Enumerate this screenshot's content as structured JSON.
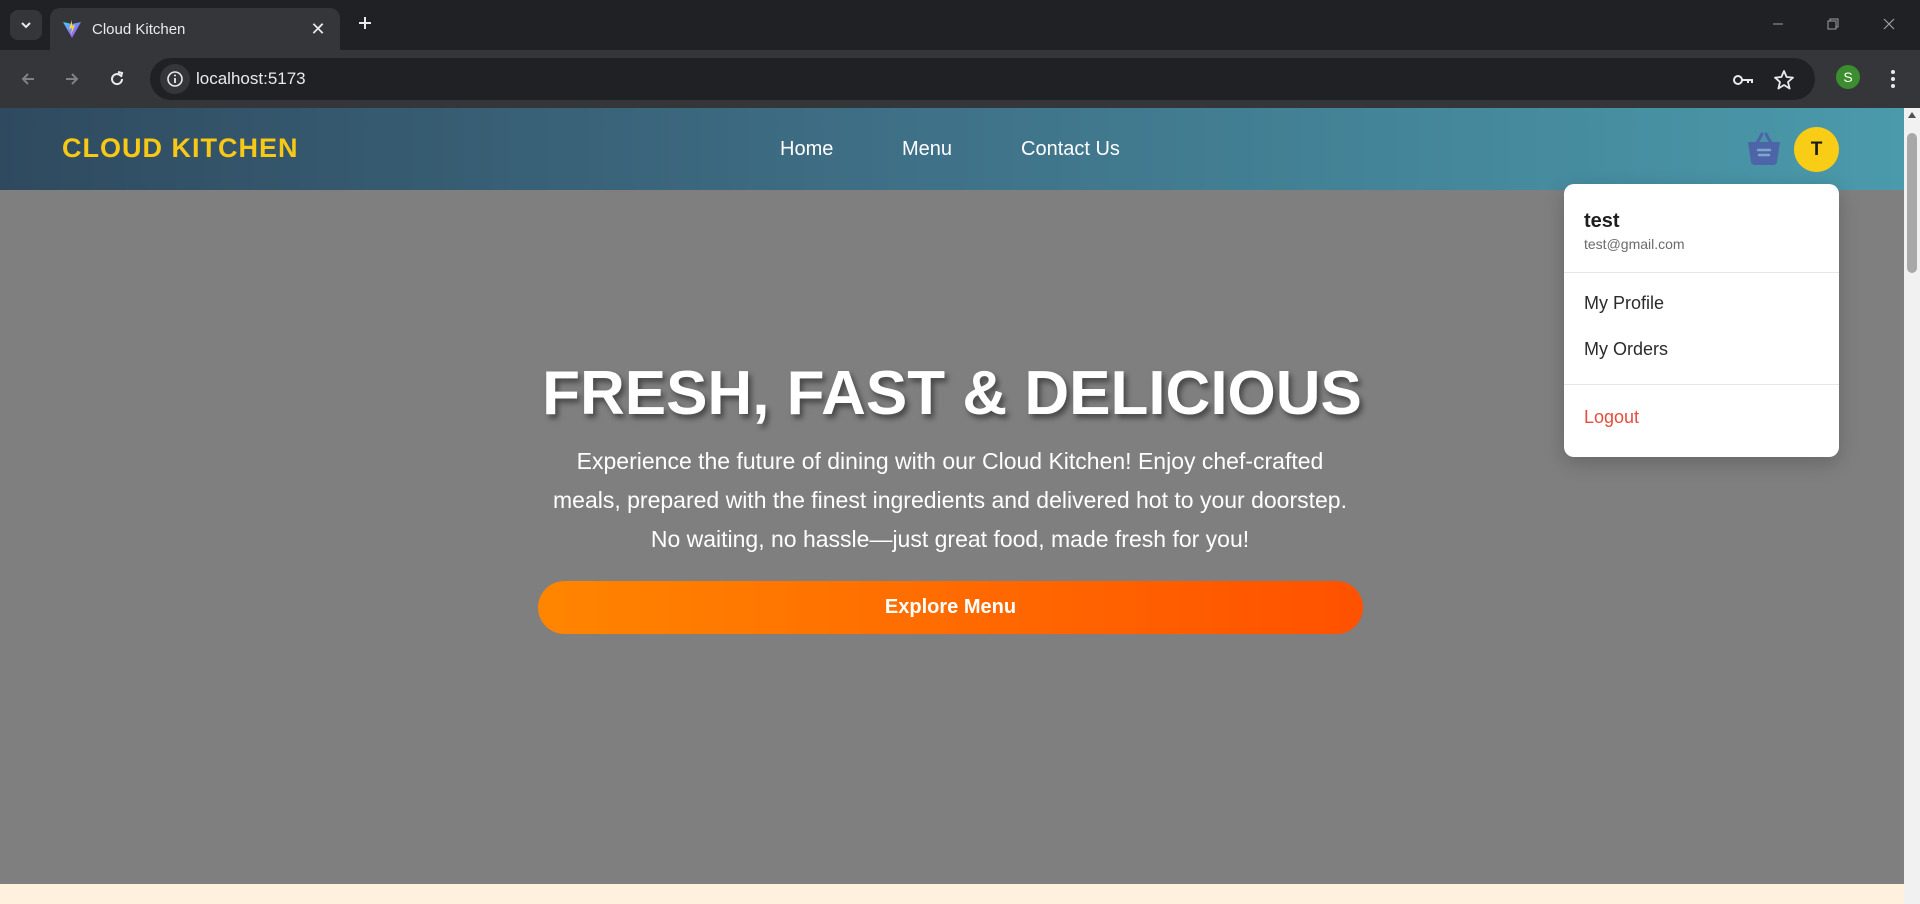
{
  "browser": {
    "tab_title": "Cloud Kitchen",
    "new_tab_icon": "plus-icon",
    "url": "localhost:5173",
    "profile_initial": "S"
  },
  "navbar": {
    "brand": "CLOUD KITCHEN",
    "links": [
      "Home",
      "Menu",
      "Contact Us"
    ],
    "avatar_initial": "T"
  },
  "hero": {
    "title": "FRESH, FAST & DELICIOUS",
    "text": "Experience the future of dining with our Cloud Kitchen! Enjoy chef-crafted meals, prepared with the finest ingredients and delivered hot to your doorstep. No waiting, no hassle—just great food, made fresh for you!",
    "cta_label": "Explore Menu"
  },
  "user_menu": {
    "name": "test",
    "email": "test@gmail.com",
    "items": [
      "My Profile",
      "My Orders"
    ],
    "logout": "Logout"
  },
  "colors": {
    "brand": "#f7c815",
    "cta_start": "#ff8500",
    "cta_end": "#ff5100",
    "logout": "#e74c3c"
  }
}
